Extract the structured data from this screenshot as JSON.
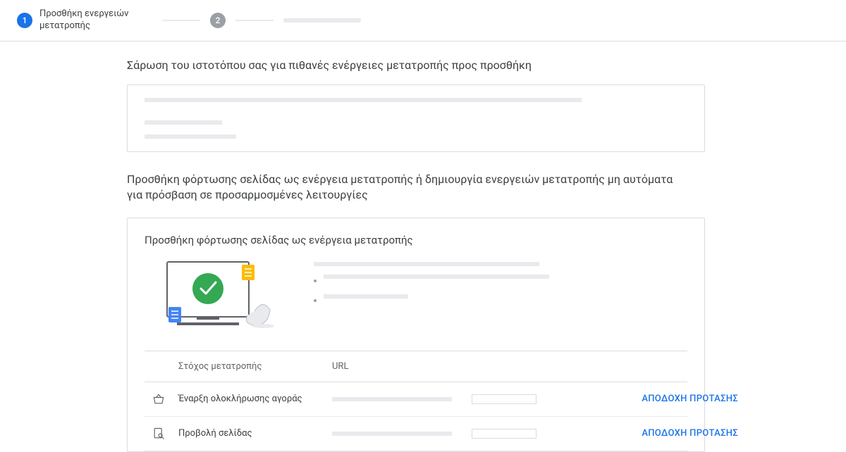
{
  "stepper": {
    "step1": {
      "num": "1",
      "label": "Προσθήκη ενεργειών μετατροπής"
    },
    "step2": {
      "num": "2"
    }
  },
  "scan": {
    "title": "Σάρωση του ιστοτόπου σας για πιθανές ενέργειες μετατροπής προς προσθήκη"
  },
  "subhead": "Προσθήκη φόρτωσης σελίδας ως ενέργεια μετατροπής ή δημιουργία ενεργειών μετατροπής μη αυτόματα για πρόσβαση σε προσαρμοσμένες λειτουργίες",
  "card": {
    "title": "Προσθήκη φόρτωσης σελίδας ως ενέργεια μετατροπής",
    "headers": {
      "goal": "Στόχος μετατροπής",
      "url": "URL"
    },
    "rows": [
      {
        "icon": "basket",
        "label": "Έναρξη ολοκλήρωσης αγοράς",
        "action": "ΑΠΟΔΟΧΗ ΠΡΟΤΑΣΗΣ"
      },
      {
        "icon": "page-search",
        "label": "Προβολή σελίδας",
        "action": "ΑΠΟΔΟΧΗ ΠΡΟΤΑΣΗΣ"
      }
    ]
  }
}
